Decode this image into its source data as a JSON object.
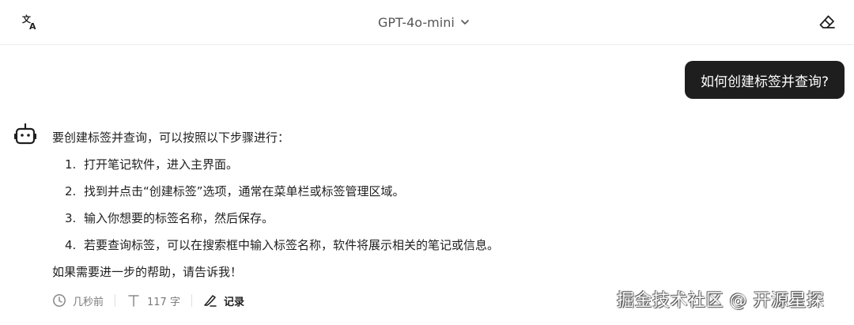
{
  "header": {
    "model_label": "GPT-4o-mini"
  },
  "chat": {
    "user_message": "如何创建标签并查询?",
    "answer": {
      "intro": "要创建标签并查询，可以按照以下步骤进行：",
      "steps": [
        {
          "num": "1.",
          "text": "打开笔记软件，进入主界面。"
        },
        {
          "num": "2.",
          "text": "找到并点击“创建标签”选项，通常在菜单栏或标签管理区域。"
        },
        {
          "num": "3.",
          "text": "输入你想要的标签名称，然后保存。"
        },
        {
          "num": "4.",
          "text": "若要查询标签，可以在搜索框中输入标签名称，软件将展示相关的笔记或信息。"
        }
      ],
      "outro": "如果需要进一步的帮助，请告诉我！"
    },
    "meta": {
      "time": "几秒前",
      "word_count": "117 字",
      "record_label": "记录"
    }
  },
  "watermark": "掘金技术社区 @ 开源星探",
  "icons": {
    "translate": "translate-icon",
    "model_dropdown": "chevron-down-icon",
    "clear": "eraser-icon",
    "bot": "robot-icon",
    "time": "clock-icon",
    "count": "text-icon",
    "record": "pen-icon"
  }
}
